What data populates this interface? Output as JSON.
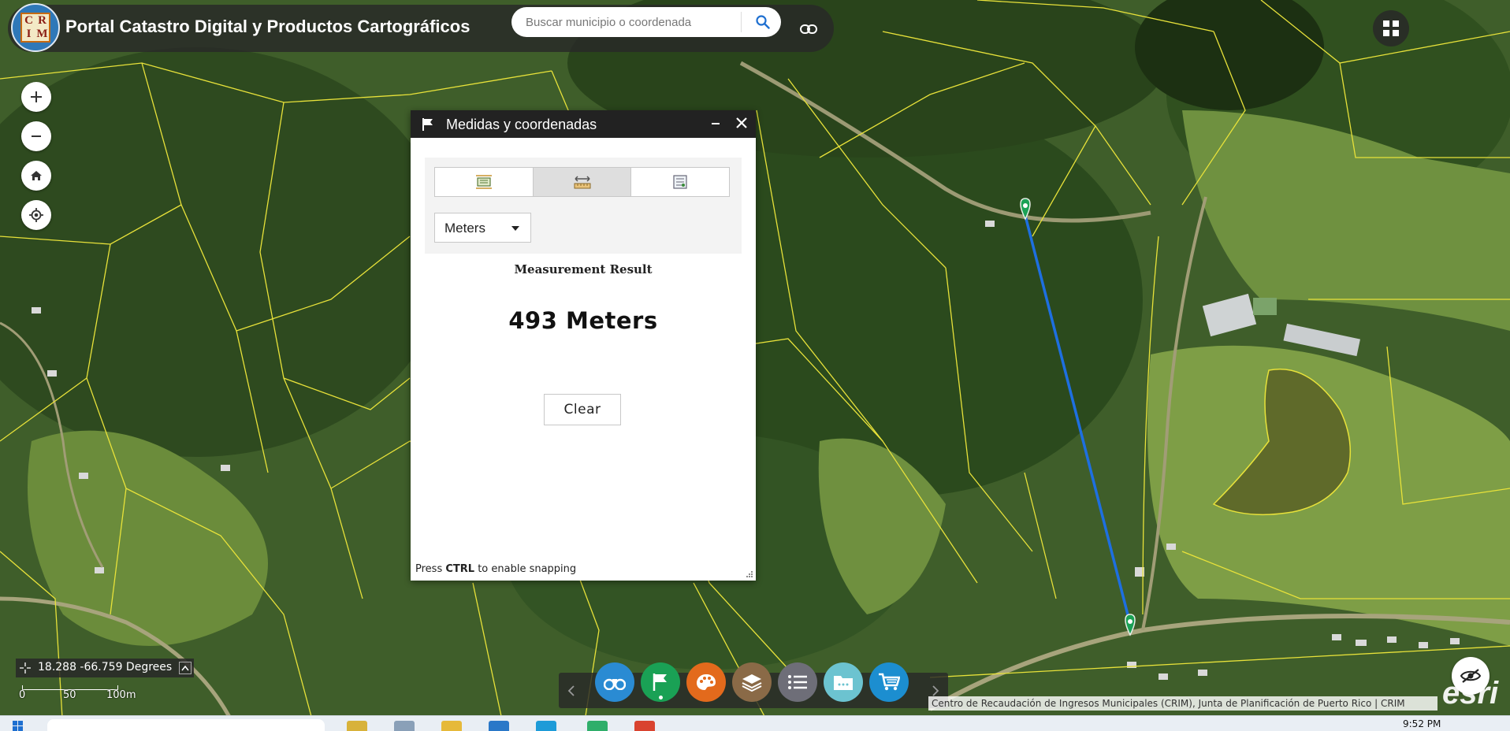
{
  "app": {
    "title": "Portal Catastro Digital y Productos Cartográficos",
    "logo_letters": [
      "C",
      "R",
      "I",
      "M"
    ]
  },
  "search": {
    "placeholder": "Buscar municipio o coordenada",
    "value": ""
  },
  "map_controls": {
    "zoom_in": "+",
    "zoom_out": "−",
    "home_icon": "home-icon",
    "locate_icon": "locate-icon"
  },
  "widget": {
    "title": "Medidas y coordenadas",
    "tools": [
      {
        "name": "area-tool",
        "icon": "area-measure-icon",
        "active": false
      },
      {
        "name": "distance-tool",
        "icon": "distance-measure-icon",
        "active": true
      },
      {
        "name": "location-tool",
        "icon": "location-measure-icon",
        "active": false
      }
    ],
    "unit": "Meters",
    "result_label": "Measurement Result",
    "result_value": "493 Meters",
    "clear_label": "Clear",
    "snap_prefix": "Press ",
    "snap_key": "CTRL",
    "snap_suffix": " to enable snapping"
  },
  "coordinates": {
    "readout": "18.288 -66.759 Degrees"
  },
  "scale": {
    "labels": [
      "0",
      "50",
      "100m"
    ]
  },
  "dock": {
    "items": [
      {
        "name": "binoculars",
        "color": "#2a8bd3"
      },
      {
        "name": "flag",
        "color": "#1aa155",
        "active": true
      },
      {
        "name": "palette",
        "color": "#e36a1c"
      },
      {
        "name": "layers",
        "color": "#8a6a47"
      },
      {
        "name": "list",
        "color": "#6e6e78"
      },
      {
        "name": "folder",
        "color": "#6cc3d0"
      },
      {
        "name": "cart",
        "color": "#1c8ed0"
      }
    ]
  },
  "attribution": "Centro de Recaudación de Ingresos Municipales (CRIM), Junta de Planificación de Puerto Rico | CRIM",
  "esri": "esri",
  "taskbar": {
    "clock": "9:52 PM"
  },
  "colors": {
    "parcel_lines": "#e8e23a",
    "measure_line": "#1e6fe0",
    "marker": "#1aa155",
    "panel_header": "#222222"
  }
}
